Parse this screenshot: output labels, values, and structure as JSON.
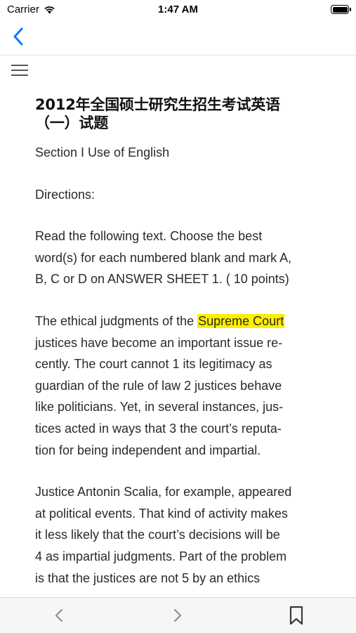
{
  "status": {
    "carrier": "Carrier",
    "time": "1:47 AM"
  },
  "nav": {
    "back_icon": "chevron-left-icon",
    "menu_icon": "hamburger-menu-icon"
  },
  "article": {
    "title_line1": "2012年全国硕士研究生招生考试英语",
    "title_line2": "（一）试题",
    "section": "Section I Use of English",
    "directions": "Directions:",
    "instructions": [
      "Read the following text. Choose the best",
      "word(s) for each numbered blank and mark A,",
      "B, C or D on ANSWER SHEET 1. ( 10 points)"
    ],
    "p1_line1_before": "The ethical judgments of the ",
    "p1_highlight": "Supreme Court",
    "p1_lines": [
      "justices have become an important issue re-",
      "cently. The court cannot  1  its legitimacy as",
      "guardian of the rule of law  2  justices behave",
      "like politicians. Yet, in several instances, jus-",
      "tices acted in ways that  3 the court’s reputa-",
      "tion for being independent and impartial."
    ],
    "p2_lines": [
      "Justice Antonin Scalia, for example, appeared",
      "at political events. That kind of activity makes",
      "it less likely that the court’s decisions will be",
      " 4  as impartial judgments. Part of the problem",
      "is that the justices are not  5 by an ethics"
    ],
    "highlight_color": "#ffee00"
  },
  "toolbar": {
    "prev_icon": "chevron-left-icon",
    "next_icon": "chevron-right-icon",
    "bookmark_icon": "bookmark-icon"
  },
  "colors": {
    "accent": "#007aff",
    "toolbar_icon": "#8e8e93"
  }
}
